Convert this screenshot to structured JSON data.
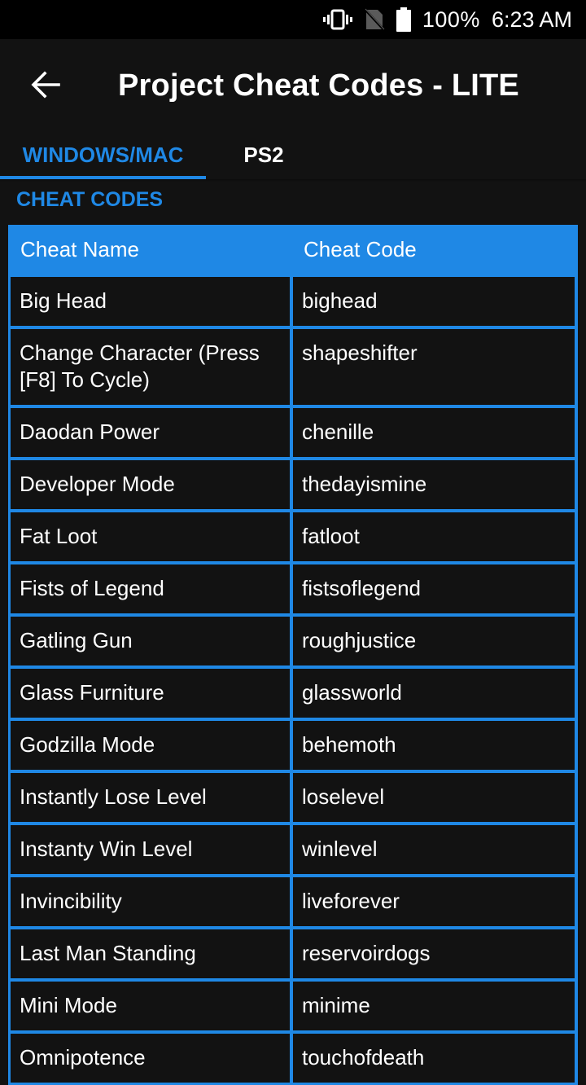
{
  "status_bar": {
    "icons": [
      "vibrate-icon",
      "no-sim-icon",
      "battery-icon"
    ],
    "battery": "100%",
    "time": "6:23 AM"
  },
  "app_bar": {
    "back_icon": "arrow-left-icon",
    "title": "Project Cheat Codes - LITE"
  },
  "tabs": [
    {
      "label": "WINDOWS/MAC",
      "active": true
    },
    {
      "label": "PS2",
      "active": false
    }
  ],
  "section": {
    "title": "CHEAT CODES"
  },
  "colors": {
    "accent": "#1f88e5",
    "background": "#121212",
    "status_bar": "#000000",
    "text": "#ffffff"
  },
  "table": {
    "headers": [
      "Cheat Name",
      "Cheat Code"
    ],
    "rows": [
      {
        "name": "Big Head",
        "code": "bighead"
      },
      {
        "name": "Change Character (Press [F8] To Cycle)",
        "code": "shapeshifter"
      },
      {
        "name": "Daodan Power",
        "code": "chenille"
      },
      {
        "name": "Developer Mode",
        "code": "thedayismine"
      },
      {
        "name": "Fat Loot",
        "code": "fatloot"
      },
      {
        "name": "Fists of Legend",
        "code": "fistsoflegend"
      },
      {
        "name": "Gatling Gun",
        "code": "roughjustice"
      },
      {
        "name": "Glass Furniture",
        "code": "glassworld"
      },
      {
        "name": "Godzilla Mode",
        "code": "behemoth"
      },
      {
        "name": "Instantly Lose Level",
        "code": "loselevel"
      },
      {
        "name": "Instanty Win Level",
        "code": "winlevel"
      },
      {
        "name": "Invincibility",
        "code": "liveforever"
      },
      {
        "name": "Last Man Standing",
        "code": "reservoirdogs"
      },
      {
        "name": "Mini Mode",
        "code": "minime"
      },
      {
        "name": "Omnipotence",
        "code": "touchofdeath"
      }
    ]
  }
}
